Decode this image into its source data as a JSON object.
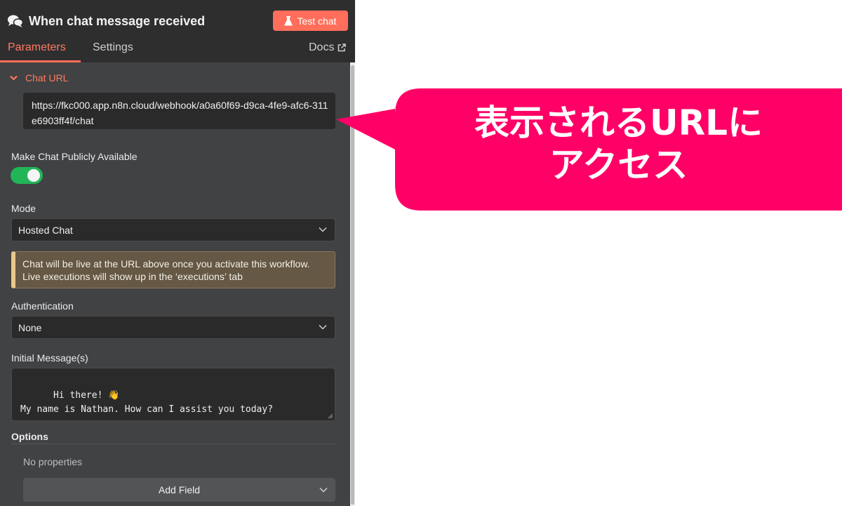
{
  "header": {
    "title": "When chat message received",
    "test_button": "Test chat",
    "title_icon": "chat-bubbles-icon",
    "test_icon": "flask-icon"
  },
  "tabs": [
    {
      "label": "Parameters",
      "active": true
    },
    {
      "label": "Settings",
      "active": false
    }
  ],
  "docs_link": "Docs",
  "chat_url": {
    "section_label": "Chat URL",
    "value": "https://fkc000.app.n8n.cloud/webhook/a0a60f69-d9ca-4fe9-afc6-311e6903ff4f/chat"
  },
  "public": {
    "label": "Make Chat Publicly Available",
    "enabled": true
  },
  "mode": {
    "label": "Mode",
    "value": "Hosted Chat"
  },
  "notice": {
    "line1": "Chat will be live at the URL above once you activate this workflow.",
    "line2": "Live executions will show up in the ‘executions’ tab"
  },
  "auth": {
    "label": "Authentication",
    "value": "None"
  },
  "initial_messages": {
    "label": "Initial Message(s)",
    "value": "Hi there! 👋\nMy name is Nathan. How can I assist you today?"
  },
  "options": {
    "label": "Options",
    "empty_text": "No properties",
    "add_button": "Add Field"
  },
  "callout": {
    "line1": "表示されるURLに",
    "line2": "アクセス"
  },
  "colors": {
    "accent": "#ff6e5b",
    "toggle_on": "#22b558",
    "callout": "#ff0066",
    "notice_bg": "#655844"
  }
}
